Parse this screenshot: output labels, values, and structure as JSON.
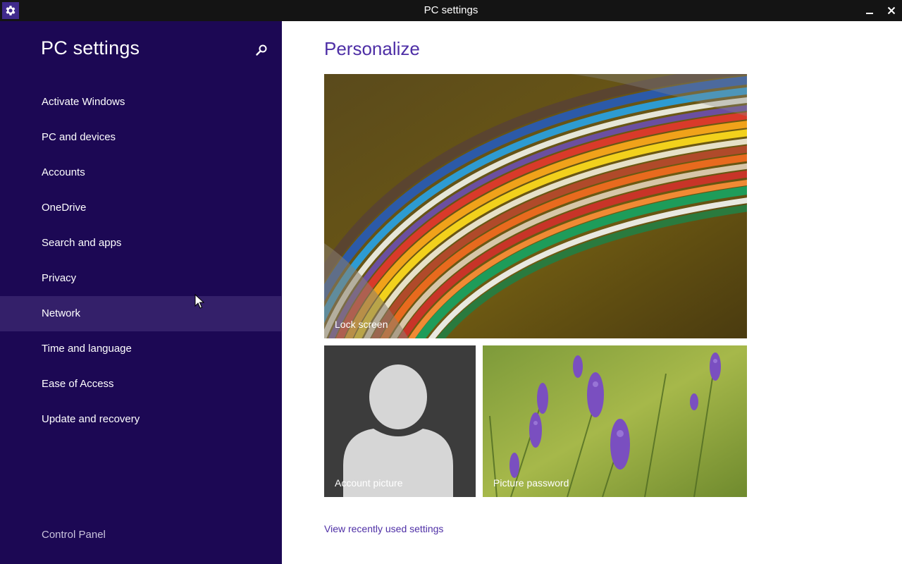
{
  "window": {
    "title": "PC settings"
  },
  "sidebar": {
    "title": "PC settings",
    "items": [
      {
        "label": "Activate Windows"
      },
      {
        "label": "PC and devices"
      },
      {
        "label": "Accounts"
      },
      {
        "label": "OneDrive"
      },
      {
        "label": "Search and apps"
      },
      {
        "label": "Privacy"
      },
      {
        "label": "Network"
      },
      {
        "label": "Time and language"
      },
      {
        "label": "Ease of Access"
      },
      {
        "label": "Update and recovery"
      }
    ],
    "hovered_item": "Network",
    "control_panel": "Control Panel"
  },
  "main": {
    "title": "Personalize",
    "tiles": {
      "lock_screen": "Lock screen",
      "account_picture": "Account picture",
      "picture_password": "Picture password"
    },
    "recent_link": "View recently used settings"
  },
  "colors": {
    "sidebar_bg": "#1c0854",
    "sidebar_hover": "#34206a",
    "accent": "#4e2fa6",
    "titlebar_bg": "#141414"
  }
}
